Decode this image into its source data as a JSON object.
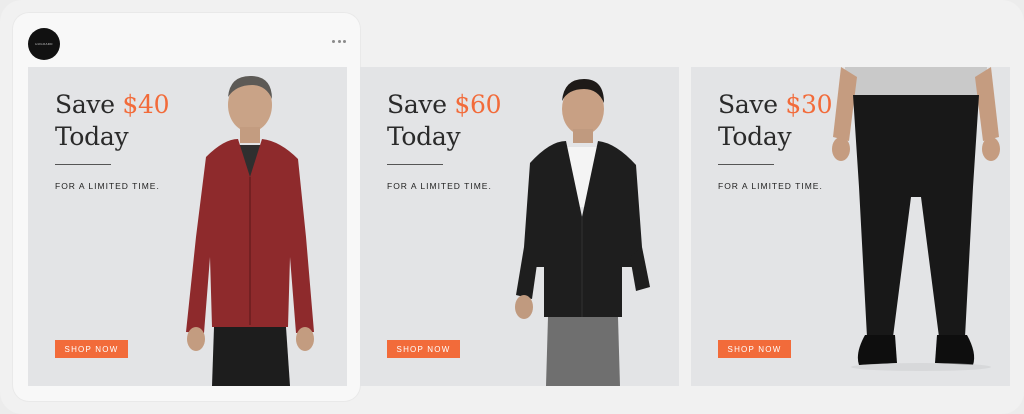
{
  "post": {
    "brand_logo_text": "HUGOADD",
    "more_icon": "more-horizontal-icon"
  },
  "ads": [
    {
      "save_prefix": "Save ",
      "amount": "$40",
      "headline_line2": "Today",
      "tagline": "FOR A LIMITED TIME.",
      "cta": "SHOP NOW",
      "product": "red zip hoodie"
    },
    {
      "save_prefix": "Save ",
      "amount": "$60",
      "headline_line2": "Today",
      "tagline": "FOR A LIMITED TIME.",
      "cta": "SHOP NOW",
      "product": "black shawl cardigan"
    },
    {
      "save_prefix": "Save ",
      "amount": "$30",
      "headline_line2": "Today",
      "tagline": "FOR A LIMITED TIME.",
      "cta": "SHOP NOW",
      "product": "black pants"
    }
  ],
  "colors": {
    "accent": "#f26b3a",
    "ad_background": "#e3e4e6",
    "frame_background": "#f1f1f1"
  }
}
